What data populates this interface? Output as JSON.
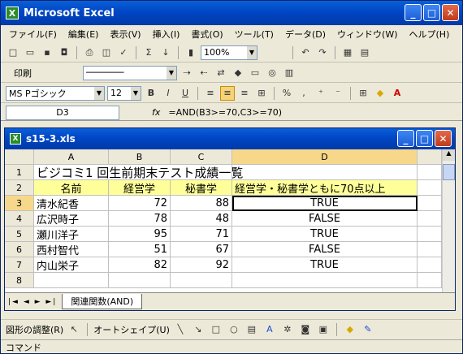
{
  "app": {
    "title": "Microsoft Excel",
    "icon_text": "X"
  },
  "window_buttons": {
    "min": "_",
    "max": "□",
    "close": "✕"
  },
  "menu": [
    "ファイル(F)",
    "編集(E)",
    "表示(V)",
    "挿入(I)",
    "書式(O)",
    "ツール(T)",
    "データ(D)",
    "ウィンドウ(W)",
    "ヘルプ(H)"
  ],
  "toolbar1": {
    "sum": "Σ",
    "zoom": "100%"
  },
  "toolbar2": {
    "print_label": "印刷"
  },
  "toolbar3": {
    "font": "MS Pゴシック",
    "size": "12",
    "bold": "B",
    "italic": "I",
    "underline": "U",
    "percent": "%",
    "comma": ","
  },
  "formula_bar": {
    "name_box": "D3",
    "fx": "fx",
    "formula": "=AND(B3>=70,C3>=70)"
  },
  "workbook": {
    "title": "s15-3.xls",
    "sheet_tab": "関連関数(AND)"
  },
  "columns": [
    "A",
    "B",
    "C",
    "D"
  ],
  "rows": [
    {
      "num": "1",
      "a": "ビジコミ1 回生前期末テスト成績一覧",
      "b": "",
      "c": "",
      "d": ""
    },
    {
      "num": "2",
      "a": "名前",
      "b": "経営学",
      "c": "秘書学",
      "d": "経営学・秘書学ともに70点以上"
    },
    {
      "num": "3",
      "a": "清水紀香",
      "b": "72",
      "c": "88",
      "d": "TRUE"
    },
    {
      "num": "4",
      "a": "広沢時子",
      "b": "78",
      "c": "48",
      "d": "FALSE"
    },
    {
      "num": "5",
      "a": "瀬川洋子",
      "b": "95",
      "c": "71",
      "d": "TRUE"
    },
    {
      "num": "6",
      "a": "西村智代",
      "b": "51",
      "c": "67",
      "d": "FALSE"
    },
    {
      "num": "7",
      "a": "内山栄子",
      "b": "82",
      "c": "92",
      "d": "TRUE"
    },
    {
      "num": "8",
      "a": "",
      "b": "",
      "c": "",
      "d": ""
    }
  ],
  "draw_toolbar": {
    "draw_adjust": "図形の調整(R)",
    "autoshape": "オートシェイプ(U)"
  },
  "status": {
    "text": "コマンド"
  }
}
